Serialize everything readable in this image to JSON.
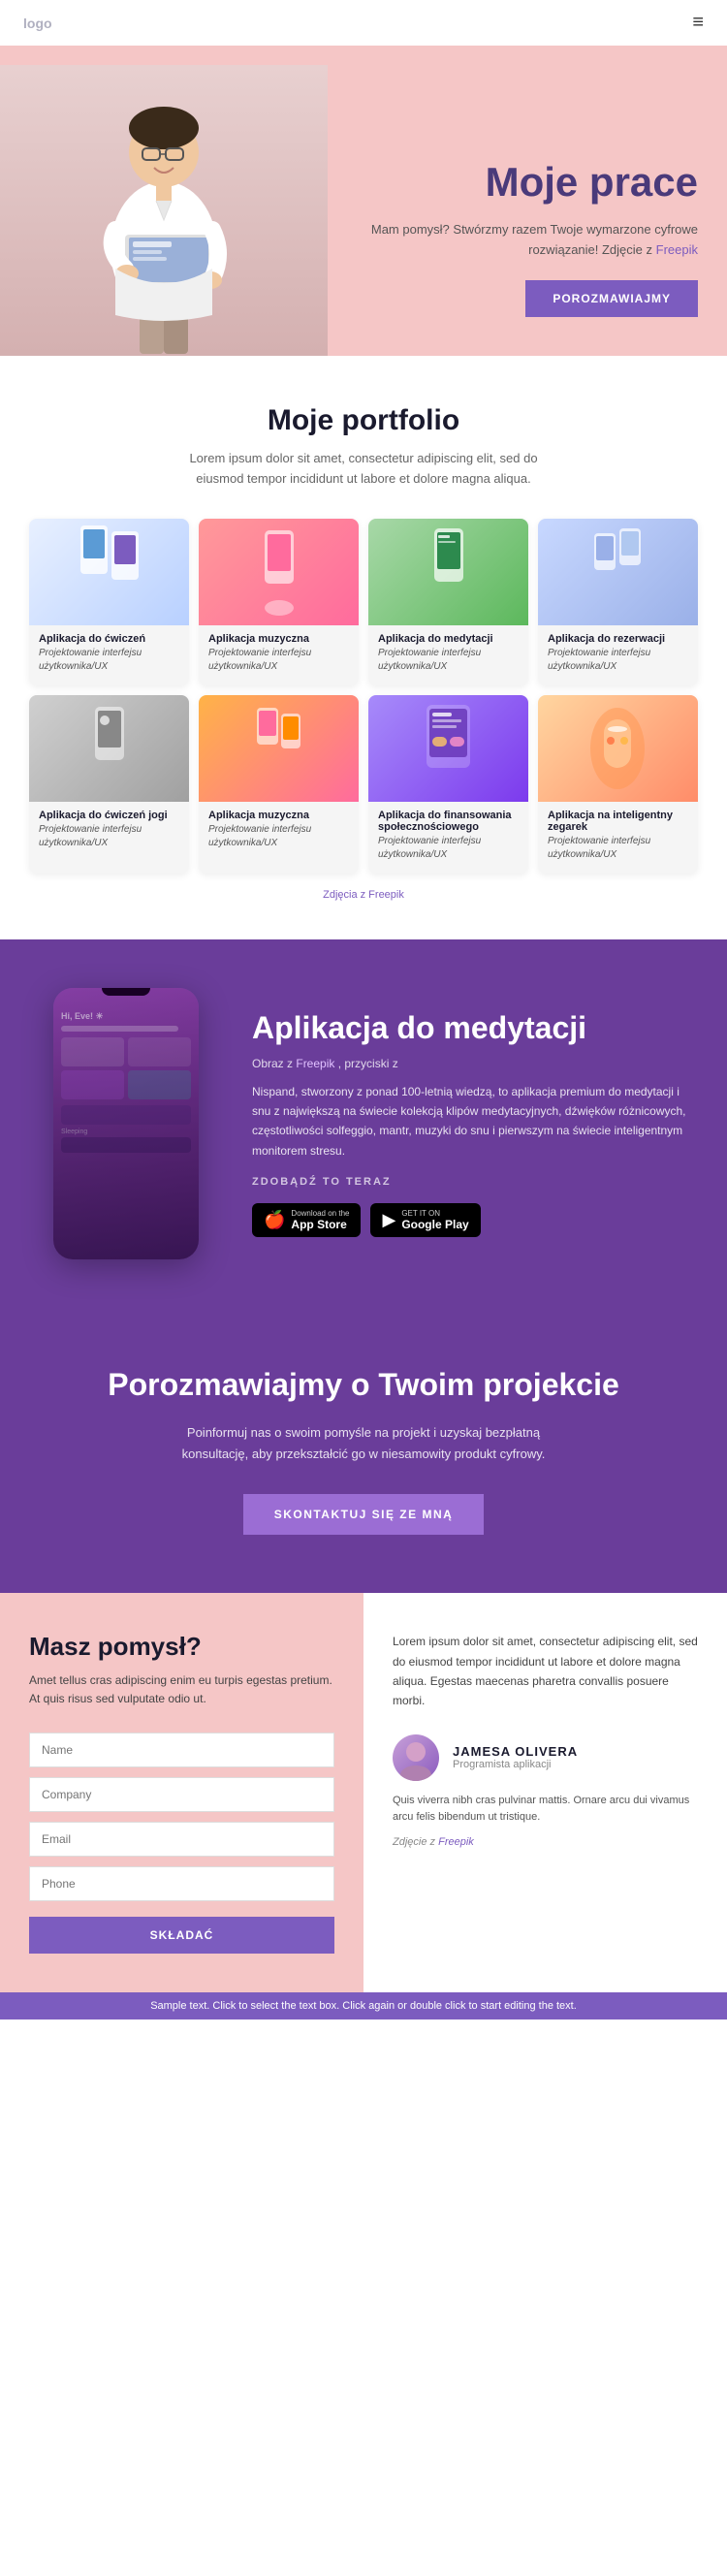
{
  "header": {
    "logo": "logo",
    "hamburger_icon": "≡"
  },
  "hero": {
    "title": "Moje prace",
    "description": "Mam pomysł? Stwórzmy razem Twoje wymarzone cyfrowe rozwiązanie! Zdjęcie z",
    "freepik_link": "Freepik",
    "cta_button": "POROZMAWIAJMY"
  },
  "portfolio": {
    "title": "Moje portfolio",
    "description": "Lorem ipsum dolor sit amet, consectetur adipiscing elit, sed do eiusmod tempor incididunt ut labore et dolore magna aliqua.",
    "items_row1": [
      {
        "name": "Aplikacja do ćwiczeń",
        "category": "Projektowanie interfejsu użytkownika/UX"
      },
      {
        "name": "Aplikacja muzyczna",
        "category": "Projektowanie interfejsu użytkownika/UX"
      },
      {
        "name": "Aplikacja do medytacji",
        "category": "Projektowanie interfejsu użytkownika/UX"
      },
      {
        "name": "Aplikacja do rezerwacji",
        "category": "Projektowanie interfejsu użytkownika/UX"
      }
    ],
    "items_row2": [
      {
        "name": "Aplikacja do ćwiczeń jogi",
        "category": "Projektowanie interfejsu użytkownika/UX"
      },
      {
        "name": "Aplikacja muzyczna",
        "category": "Projektowanie interfejsu użytkownika/UX"
      },
      {
        "name": "Aplikacja do finansowania społecznościowego",
        "category": "Projektowanie interfejsu użytkownika/UX"
      },
      {
        "name": "Aplikacja na inteligentny zegarek",
        "category": "Projektowanie interfejsu użytkownika/UX"
      }
    ],
    "freepik_credit": "Zdjęcia z Freepik"
  },
  "meditation": {
    "title": "Aplikacja do medytacji",
    "subtitle_prefix": "Obraz z",
    "subtitle_link": "Freepik",
    "subtitle_suffix": ", przyciski z",
    "description": "Nispand, stworzony z ponad 100-letnią wiedzą, to aplikacja premium do medytacji i snu z największą na świecie kolekcją klipów medytacyjnych, dźwięków różnicowych, częstotliwości solfeggio, mantr, muzyki do snu i pierwszym na świecie inteligentnym monitorem stresu.",
    "cta_text": "ZDOBĄDŹ TO TERAZ",
    "app_store_prefix": "Download on the",
    "app_store_name": "App Store",
    "google_play_prefix": "GET IT ON",
    "google_play_name": "Google Play"
  },
  "cta_section": {
    "title": "Porozmawiajmy o Twoim projekcie",
    "description": "Poinformuj nas o swoim pomyśle na projekt i uzyskaj bezpłatną konsultację, aby przekształcić go w niesamowity produkt cyfrowy.",
    "button": "SKONTAKTUJ SIĘ ZE MNĄ"
  },
  "contact": {
    "left": {
      "title": "Masz pomysł?",
      "description": "Amet tellus cras adipiscing enim eu turpis egestas pretium. At quis risus sed vulputate odio ut.",
      "form": {
        "name_placeholder": "Name",
        "company_placeholder": "Company",
        "email_placeholder": "Email",
        "phone_placeholder": "Phone",
        "submit_button": "SKŁADAĆ"
      }
    },
    "right": {
      "testimonial_text": "Lorem ipsum dolor sit amet, consectetur adipiscing elit, sed do eiusmod tempor incididunt ut labore et dolore magna aliqua. Egestas maecenas pharetra convallis posuere morbi.",
      "author_name": "JAMESA OLIVERA",
      "author_role": "Programista aplikacji",
      "quote": "Quis viverra nibh cras pulvinar mattis. Ornare arcu dui vivamus arcu felis bibendum ut tristique.",
      "credit_text": "Zdjęcie z",
      "credit_link": "Freepik"
    }
  },
  "sample_bar": {
    "text": "Sample text. Click to select the text box. Click again or double click to start editing the text."
  }
}
